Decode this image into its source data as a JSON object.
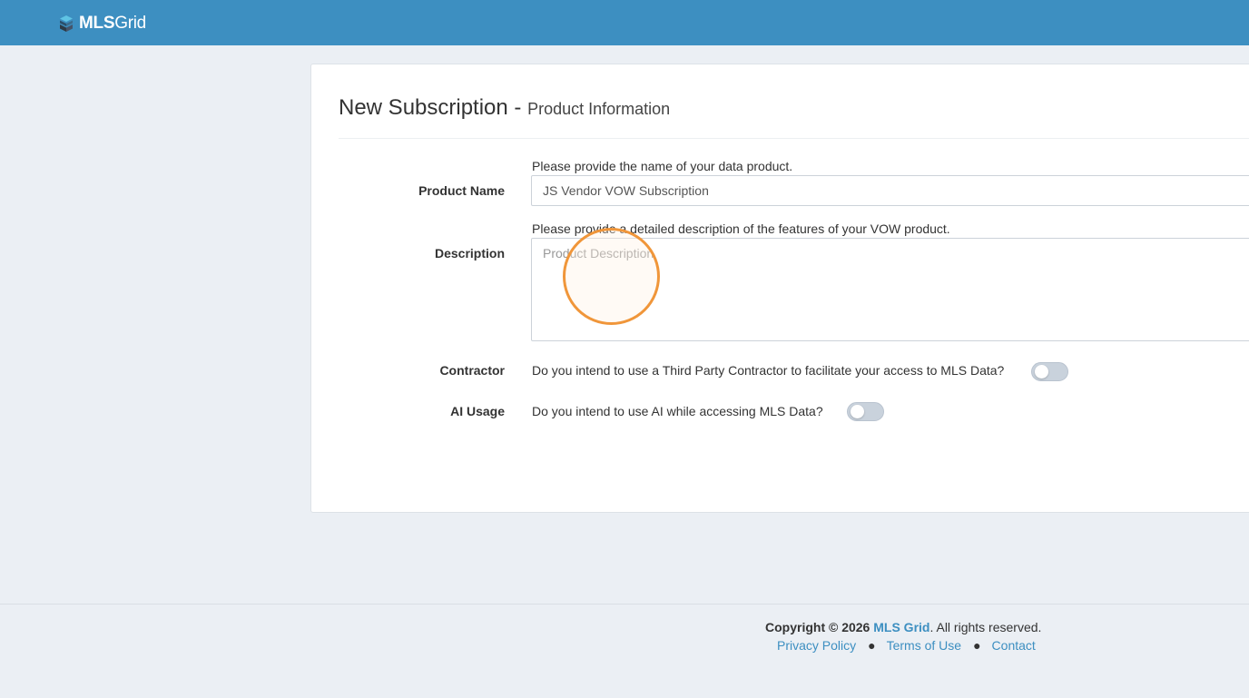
{
  "header": {
    "logo_bold": "MLS",
    "logo_light": "Grid"
  },
  "page": {
    "title": "New Subscription -",
    "subtitle": "Product Information"
  },
  "form": {
    "product_name": {
      "label": "Product Name",
      "help": "Please provide the name of your data product.",
      "value": "JS Vendor VOW Subscription"
    },
    "description": {
      "label": "Description",
      "help": "Please provide a detailed description of the features of your VOW product.",
      "placeholder": "Product Description"
    },
    "contractor": {
      "label": "Contractor",
      "question": "Do you intend to use a Third Party Contractor to facilitate your access to MLS Data?",
      "enabled": false
    },
    "ai_usage": {
      "label": "AI Usage",
      "question": "Do you intend to use AI while accessing MLS Data?",
      "enabled": false
    }
  },
  "footer": {
    "copyright_prefix": "Copyright © 2026",
    "brand_link": "MLS Grid",
    "copyright_suffix": ". All rights reserved.",
    "links": [
      "Privacy Policy",
      "Terms of Use",
      "Contact"
    ]
  },
  "colors": {
    "brand": "#3d8fc1",
    "background": "#ebeff4",
    "click_marker": "#f0963a"
  }
}
